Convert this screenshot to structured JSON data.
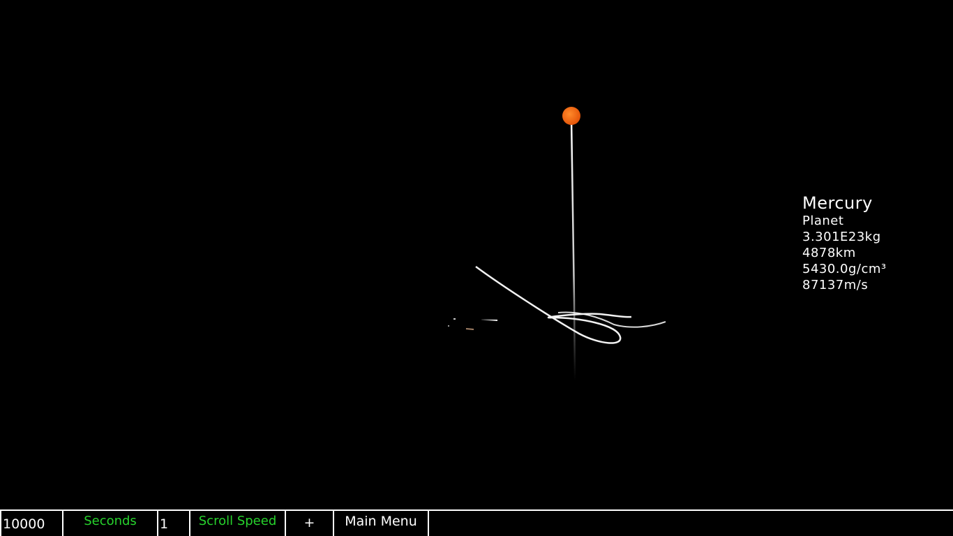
{
  "info": {
    "name": "Mercury",
    "type": "Planet",
    "mass": "3.301E23kg",
    "diameter": "4878km",
    "density": "5430.0g/cm³",
    "speed": "87137m/s"
  },
  "toolbar": {
    "time_value": "10000",
    "time_unit": "Seconds",
    "scroll_value": "1",
    "scroll_label": "Scroll Speed",
    "plus_label": "+",
    "menu_label": "Main Menu"
  },
  "colors": {
    "background": "#000000",
    "planet": "#f26a10",
    "orbit": "#ffffff",
    "toolbar_text_accent": "#27d32d"
  },
  "icons": {
    "planet": "orange-sphere-icon"
  }
}
